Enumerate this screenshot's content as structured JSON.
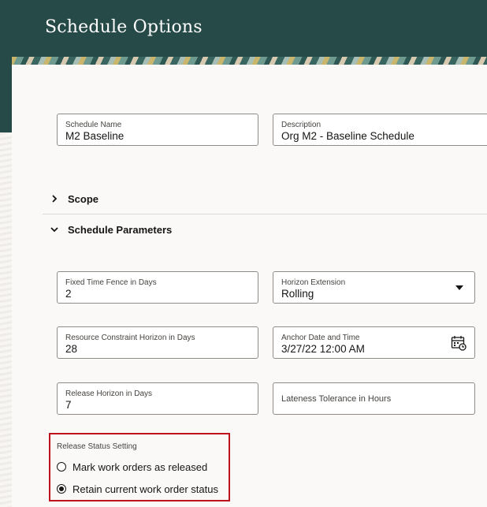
{
  "header": {
    "title": "Schedule Options"
  },
  "fields": {
    "schedule_name": {
      "label": "Schedule Name",
      "value": "M2 Baseline"
    },
    "description": {
      "label": "Description",
      "value": "Org M2 - Baseline Schedule"
    },
    "fixed_time_fence": {
      "label": "Fixed Time Fence in Days",
      "value": "2"
    },
    "horizon_extension": {
      "label": "Horizon Extension",
      "value": "Rolling"
    },
    "resource_constraint": {
      "label": "Resource Constraint Horizon in Days",
      "value": "28"
    },
    "anchor_date": {
      "label": "Anchor Date and Time",
      "value": "3/27/22 12:00 AM"
    },
    "release_horizon": {
      "label": "Release Horizon in Days",
      "value": "7"
    },
    "lateness_tolerance": {
      "label": "Lateness Tolerance in Hours",
      "value": ""
    }
  },
  "sections": {
    "scope": {
      "label": "Scope",
      "expanded": false
    },
    "schedule_parameters": {
      "label": "Schedule Parameters",
      "expanded": true
    }
  },
  "release_status": {
    "label": "Release Status Setting",
    "options": [
      {
        "label": "Mark work orders as released",
        "selected": false
      },
      {
        "label": "Retain current work order status",
        "selected": true
      }
    ]
  },
  "icons": {
    "dropdown": "chevron-down-icon",
    "calendar": "calendar-icon",
    "collapsed": "chevron-right-icon",
    "expanded": "chevron-down-icon"
  },
  "colors": {
    "header": "#264a48",
    "highlight": "#c0121e"
  }
}
